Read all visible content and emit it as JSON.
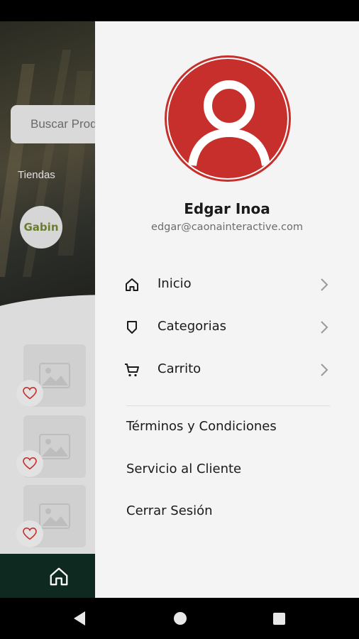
{
  "background_app": {
    "search_placeholder": "Buscar Productos",
    "stores_label": "Tiendas",
    "store_logo_text": "Gabin",
    "icons": {
      "favorite": "heart-icon",
      "image_placeholder": "image-icon",
      "home": "home-icon"
    }
  },
  "drawer": {
    "user": {
      "name": "Edgar Inoa",
      "email": "edgar@caonainteractive.com"
    },
    "menu": [
      {
        "label": "Inicio",
        "icon": "home-icon"
      },
      {
        "label": "Categorias",
        "icon": "tag-icon"
      },
      {
        "label": "Carrito",
        "icon": "cart-icon"
      }
    ],
    "links": [
      {
        "label": "Términos y Condiciones"
      },
      {
        "label": "Servicio al Cliente"
      },
      {
        "label": "Cerrar Sesión"
      }
    ]
  },
  "colors": {
    "avatar_bg": "#c62f2b",
    "favorite": "#c62f2b",
    "bottom_nav": "#0e2a20",
    "drawer_bg": "#f4f4f4"
  }
}
